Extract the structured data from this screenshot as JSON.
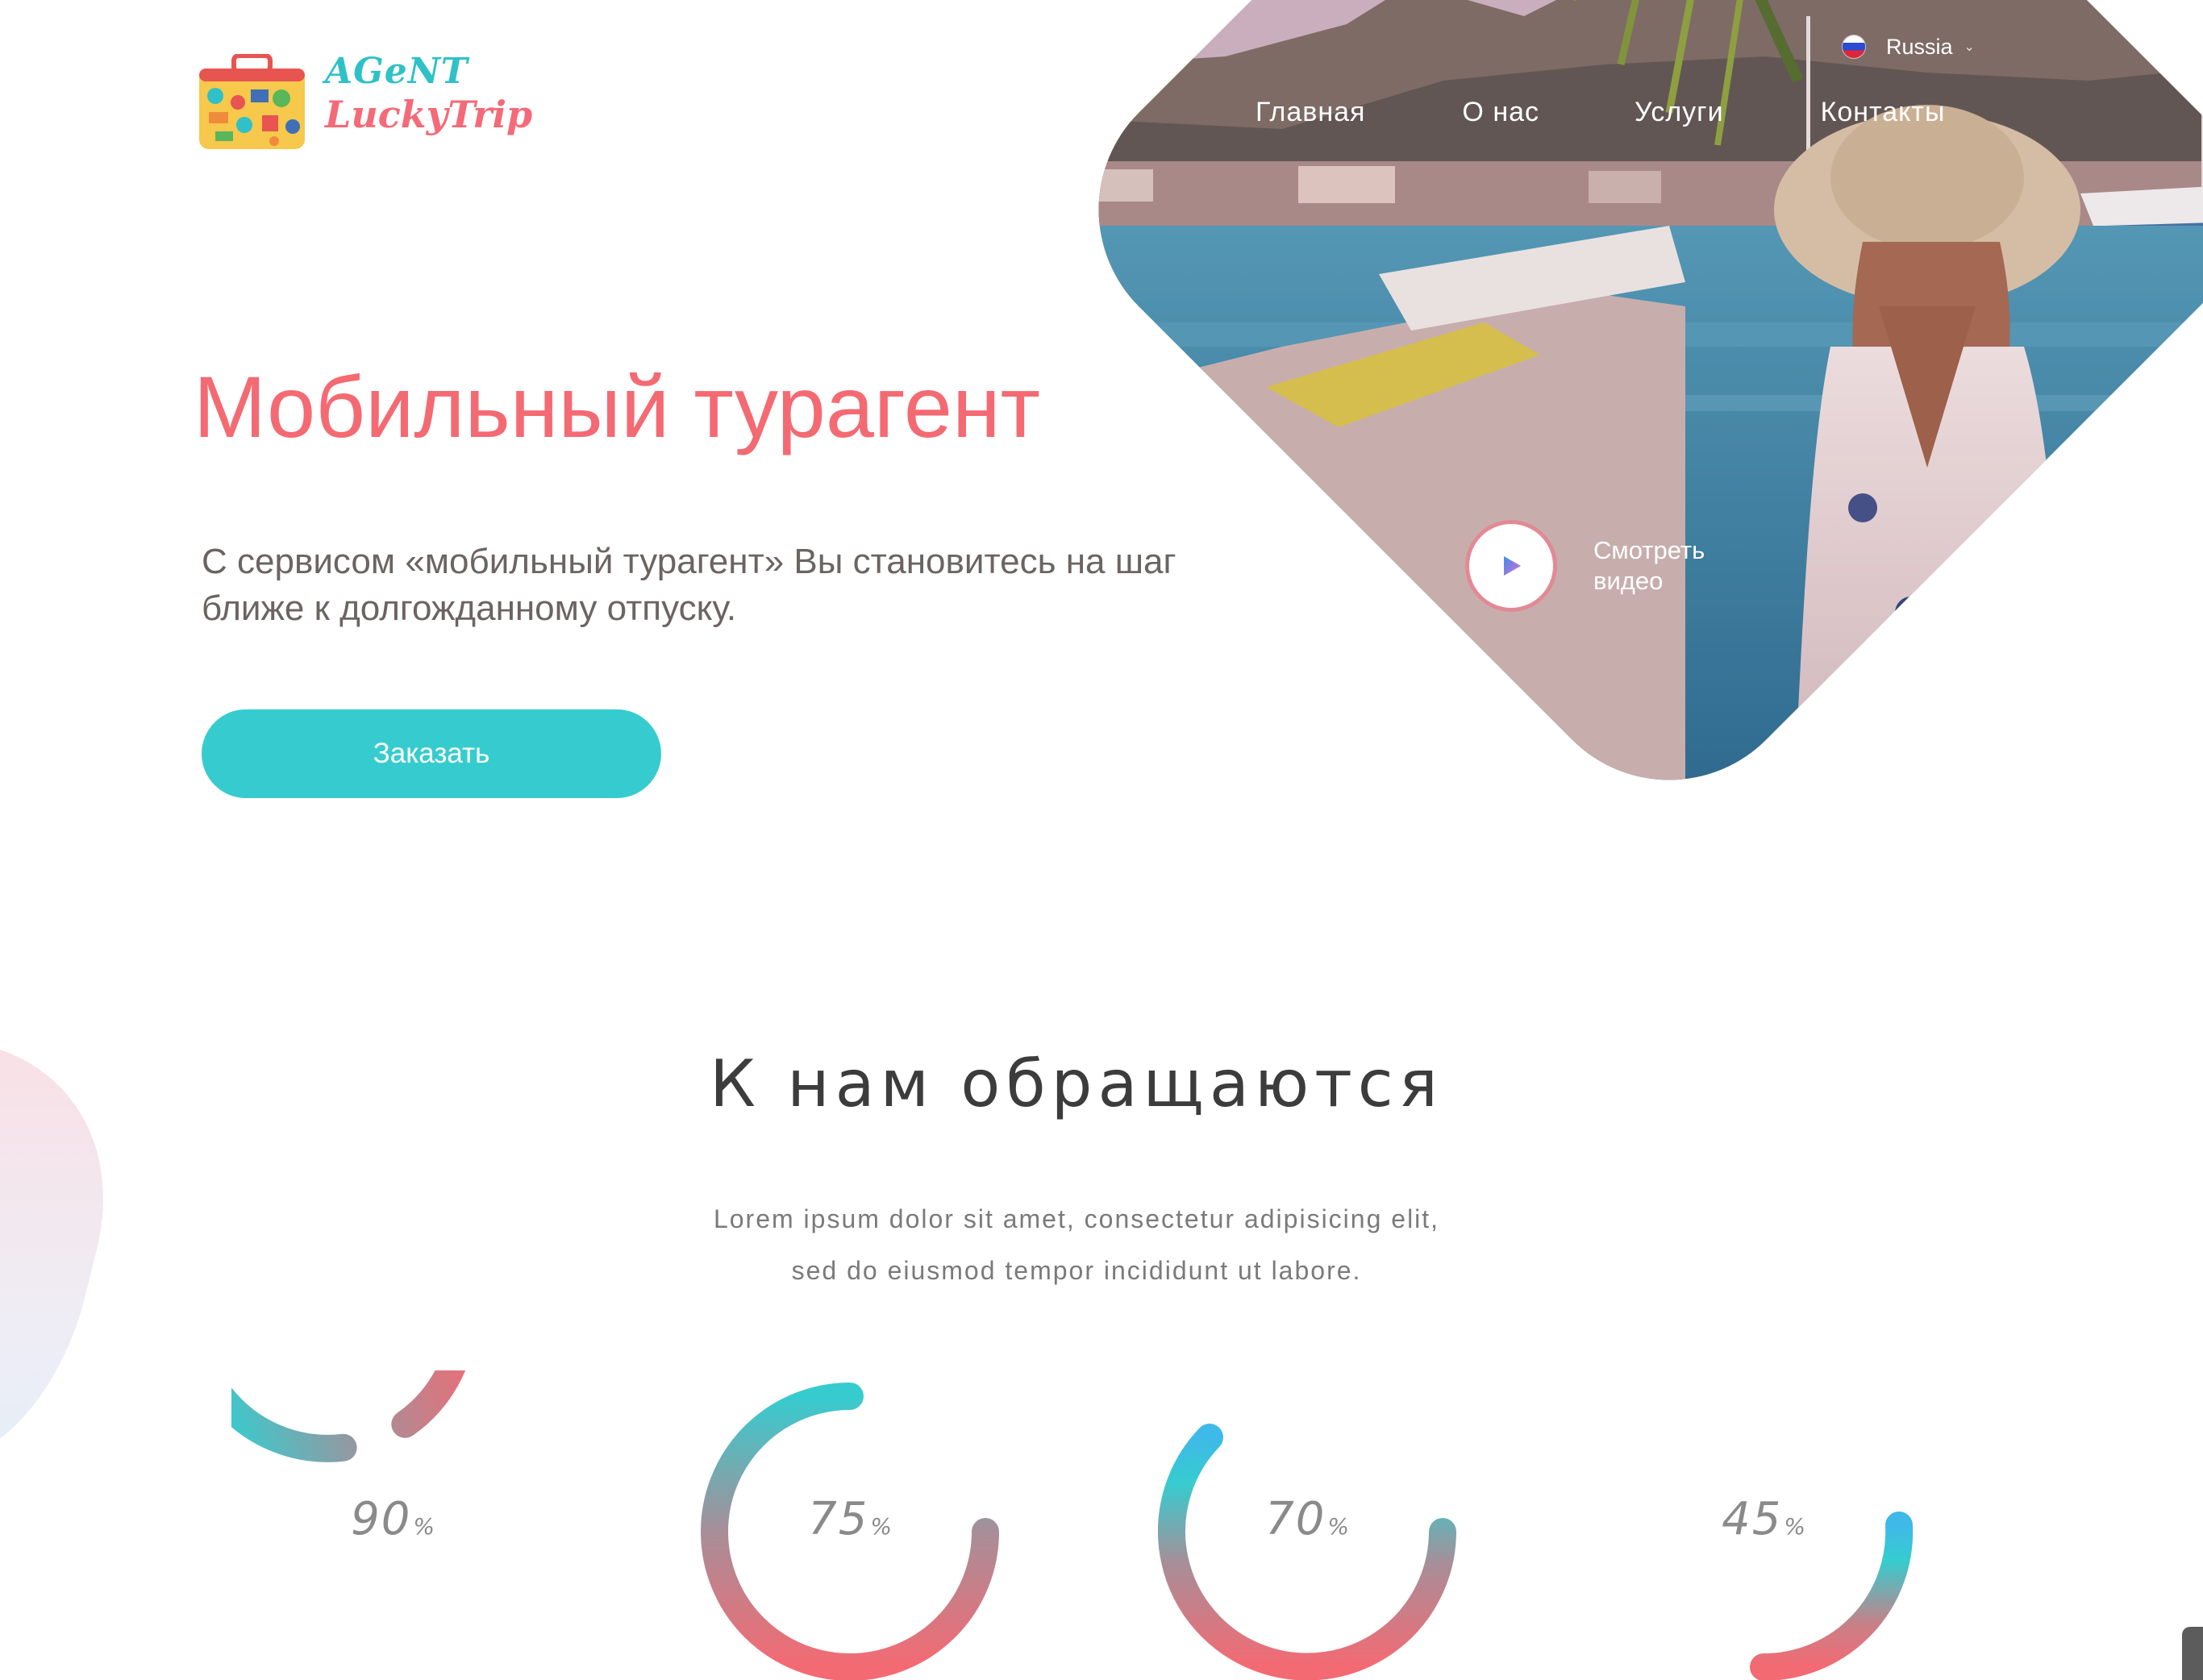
{
  "header": {
    "logo": {
      "line1": "AGeNT",
      "line2": "LuckyTrip"
    },
    "language": {
      "selected": "Russia",
      "flag_icon": "russia-flag-icon",
      "caret_icon": "chevron-down-icon"
    },
    "nav": [
      {
        "label": "Главная"
      },
      {
        "label": "О нас"
      },
      {
        "label": "Услуги"
      },
      {
        "label": "Контакты"
      }
    ]
  },
  "hero": {
    "title": "Мобильный турагент",
    "subtitle": "С сервисом «мобильный турагент» Вы становитесь на шаг ближе к долгожданному отпуску.",
    "order_button": "Заказать",
    "video": {
      "label": "Смотреть видео",
      "icon": "play-icon"
    }
  },
  "clients": {
    "title": "К нам обращаются",
    "subtitle_line1": "Lorem ipsum dolor sit amet, consectetur adipisicing elit,",
    "subtitle_line2": "sed do eiusmod tempor incididunt ut labore.",
    "stats": [
      {
        "value": "90",
        "unit": "%"
      },
      {
        "value": "75",
        "unit": "%"
      },
      {
        "value": "70",
        "unit": "%"
      },
      {
        "value": "45",
        "unit": "%"
      }
    ]
  },
  "colors": {
    "accent_coral": "#f46a73",
    "accent_turquoise": "#36cccf",
    "text_gray": "#6b6462",
    "ring_gradient_top": "#36cccf",
    "ring_gradient_bottom": "#f46a73",
    "ring_tip_blue": "#3fb9e8"
  }
}
